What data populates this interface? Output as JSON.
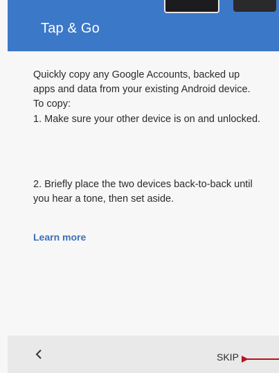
{
  "header": {
    "title": "Tap & Go",
    "color": "#3c78c8"
  },
  "content": {
    "intro": "Quickly copy any Google Accounts, backed up apps and data from your existing Android device. To copy:",
    "step1": "1. Make sure your other device is on and unlocked.",
    "step2": "2. Briefly place the two devices back-to-back until you hear a tone, then set aside.",
    "learn_more": "Learn more"
  },
  "footer": {
    "back_label": "<",
    "skip_label": "SKIP"
  },
  "colors": {
    "link": "#3c6fb8",
    "annotation_arrow": "#b3141e"
  },
  "icons": {
    "back": "chevron-left-icon",
    "annotation": "arrow-right-icon"
  }
}
